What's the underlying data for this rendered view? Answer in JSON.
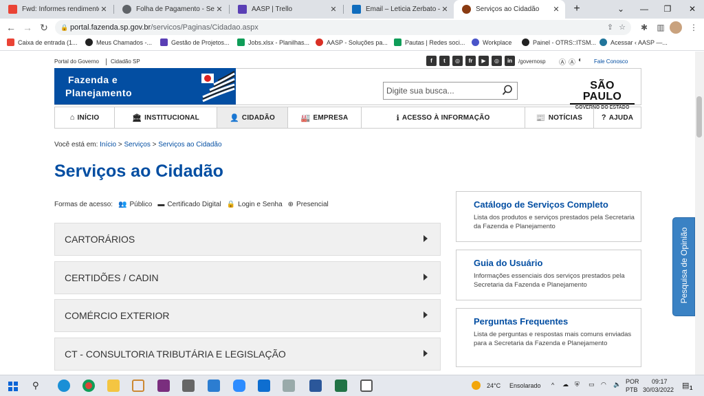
{
  "browser": {
    "tabs": [
      {
        "title": "Fwd: Informes rendimentos a",
        "icon": "gmail-icon",
        "color": "#ea4335",
        "active": false
      },
      {
        "title": "Folha de Pagamento - Secret",
        "icon": "globe-icon",
        "color": "#5f6368",
        "active": false
      },
      {
        "title": "AASP | Trello",
        "icon": "trello-icon",
        "color": "#5a3fb5",
        "active": false
      },
      {
        "title": "Email – Leticia Zerbato – Out",
        "icon": "outlook-icon",
        "color": "#0f6cbd",
        "active": false
      },
      {
        "title": "Serviços ao Cidadão",
        "icon": "sp-site-icon",
        "color": "#8a3b12",
        "active": true
      }
    ],
    "new_tab_symbol": "+",
    "url_host": "portal.fazenda.sp.gov.br",
    "url_path": "/servicos/Paginas/Cidadao.aspx",
    "bookmarks": [
      {
        "label": "Caixa de entrada (1...",
        "icon": "gmail-icon",
        "color": "#ea4335"
      },
      {
        "label": "Meus Chamados -...",
        "icon": "otrs-icon",
        "color": "#222222"
      },
      {
        "label": "Gestão de Projetos...",
        "icon": "trello-icon",
        "color": "#5a3fb5"
      },
      {
        "label": "Jobs.xlsx - Planilhas...",
        "icon": "sheets-icon",
        "color": "#0f9d58"
      },
      {
        "label": "AASP - Soluções pa...",
        "icon": "aasp-icon",
        "color": "#d93025"
      },
      {
        "label": "Pautas | Redes soci...",
        "icon": "sheets-icon",
        "color": "#0f9d58"
      },
      {
        "label": "Workplace",
        "icon": "workplace-icon",
        "color": "#4a55c9"
      },
      {
        "label": "Painel - OTRS::ITSM...",
        "icon": "otrs-icon",
        "color": "#222222"
      },
      {
        "label": "Acessar ‹ AASP —...",
        "icon": "wordpress-icon",
        "color": "#21759b"
      }
    ]
  },
  "site": {
    "top_links": [
      "Portal do Governo",
      "Cidadão SP"
    ],
    "social": [
      "f",
      "t",
      "◎",
      "fr",
      "▶",
      "◎",
      "in"
    ],
    "social_handle": "/governosp",
    "fale_conosco": "Fale Conosco",
    "brand_line1": "Fazenda e",
    "brand_line2": "Planejamento",
    "search_placeholder": "Digite sua busca...",
    "logo_line1": "SÃO PAULO",
    "logo_line2": "GOVERNO DO ESTADO",
    "menu": [
      {
        "label": "INÍCIO",
        "icon": "home-icon",
        "glyph": "⌂"
      },
      {
        "label": "INSTITUCIONAL",
        "icon": "institution-icon",
        "glyph": "🏛"
      },
      {
        "label": "CIDADÃO",
        "icon": "person-icon",
        "glyph": "👤"
      },
      {
        "label": "EMPRESA",
        "icon": "industry-icon",
        "glyph": "🏭"
      },
      {
        "label": "ACESSO À INFORMAÇÃO",
        "icon": "info-icon",
        "glyph": "ℹ"
      },
      {
        "label": "NOTÍCIAS",
        "icon": "newspaper-icon",
        "glyph": "📰"
      },
      {
        "label": "AJUDA",
        "icon": "help-icon",
        "glyph": "?"
      }
    ],
    "breadcrumb_prefix": "Você está em:",
    "breadcrumb": [
      "Início",
      "Serviços",
      "Serviços ao Cidadão"
    ],
    "breadcrumb_sep": ">",
    "page_title": "Serviços ao Cidadão",
    "access_label": "Formas de acesso:",
    "access_modes": [
      {
        "label": "Público",
        "icon": "users-icon",
        "glyph": "👥"
      },
      {
        "label": "Certificado Digital",
        "icon": "card-icon",
        "glyph": "▬"
      },
      {
        "label": "Login e Senha",
        "icon": "lock-icon",
        "glyph": "🔒"
      },
      {
        "label": "Presencial",
        "icon": "plus-circle-icon",
        "glyph": "⊕"
      }
    ],
    "categories": [
      "CARTORÁRIOS",
      "CERTIDÕES / CADIN",
      "COMÉRCIO EXTERIOR",
      "CT - CONSULTORIA TRIBUTÁRIA E LEGISLAÇÃO"
    ],
    "cards": [
      {
        "title": "Catálogo de Serviços Completo",
        "desc": "Lista dos produtos e serviços prestados pela Secretaria da Fazenda e Planejamento"
      },
      {
        "title": "Guia do Usuário",
        "desc": "Informações essenciais dos serviços prestados pela Secretaria da Fazenda e Planejamento"
      },
      {
        "title": "Perguntas Frequentes",
        "desc": "Lista de perguntas e respostas mais comuns enviadas para a Secretaria da Fazenda e Planejamento"
      }
    ],
    "feedback_tab": "Pesquisa de Opinião"
  },
  "taskbar": {
    "weather_temp": "24°C",
    "weather_desc": "Ensolarado",
    "lang_line1": "POR",
    "lang_line2": "PTB",
    "time": "09:17",
    "date": "30/03/2022",
    "notification_count": "1"
  }
}
